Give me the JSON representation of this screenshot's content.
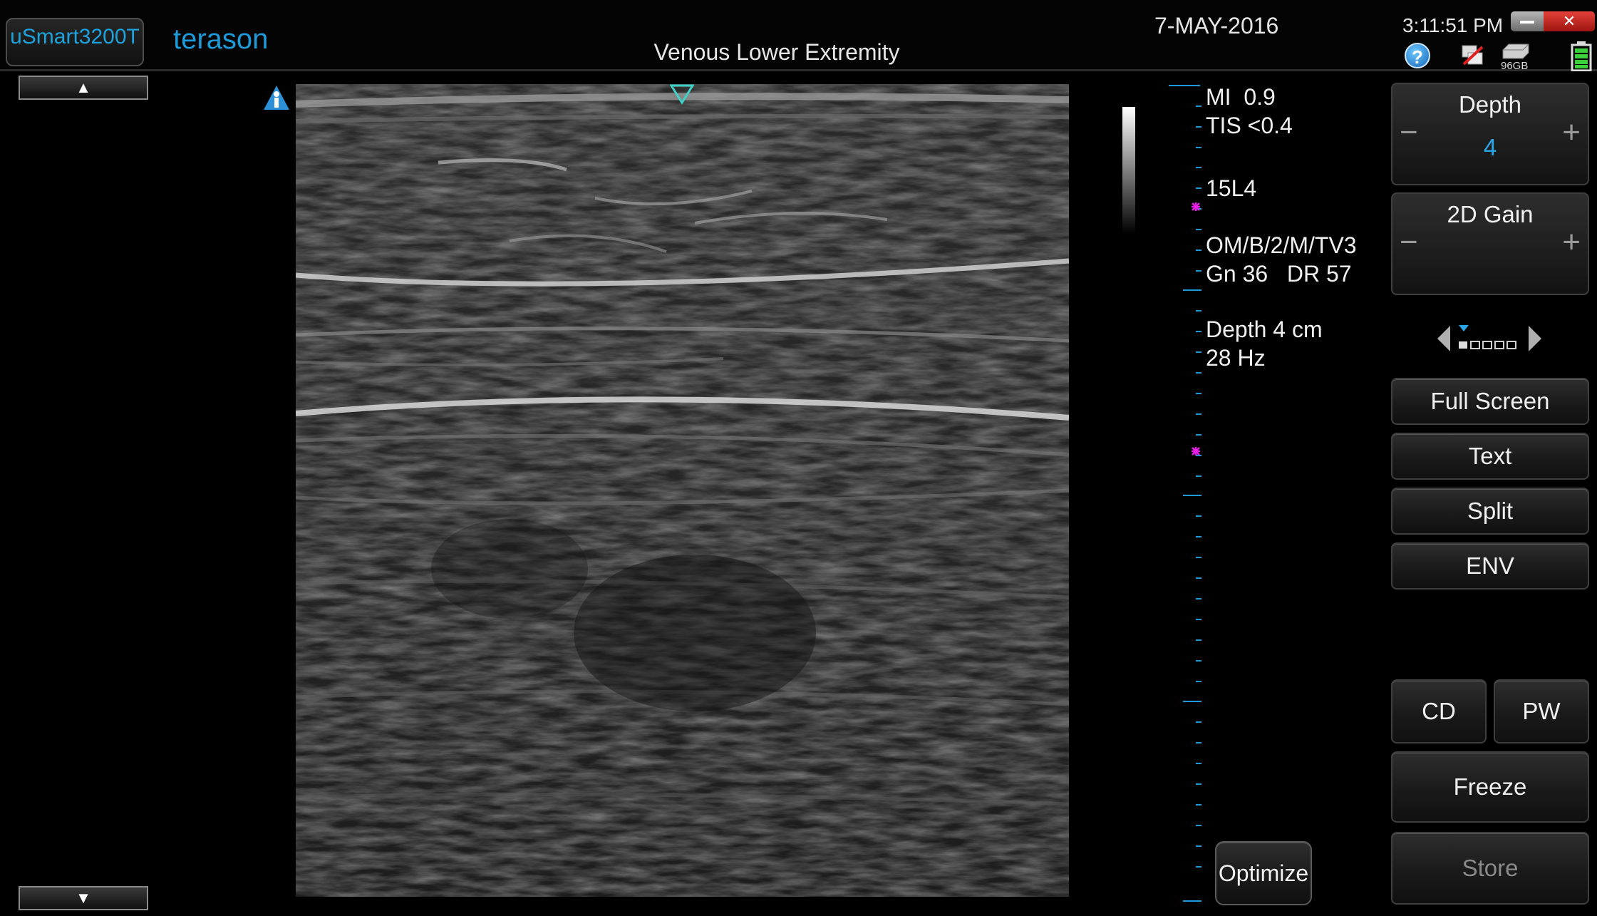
{
  "header": {
    "app_button": "uSmart3200T",
    "brand": "terason",
    "exam_title": "Venous Lower Extremity",
    "date": "7-MAY-2016",
    "time": "3:11:51 PM",
    "help_icon": "help-icon",
    "drive_label": "96GB"
  },
  "left_panel": {
    "scroll_up": "▲",
    "scroll_down": "▼"
  },
  "parameters": {
    "mi": "MI  0.9",
    "tis": "TIS <0.4",
    "transducer": "15L4",
    "mode": "OM/B/2/M/TV3",
    "gain_dr": "Gn 36   DR 57",
    "depth": "Depth 4 cm",
    "frame_rate": "28 Hz"
  },
  "controls": {
    "depth": {
      "label": "Depth",
      "value": "4",
      "minus": "−",
      "plus": "+"
    },
    "gain": {
      "label": "2D Gain",
      "minus": "−",
      "plus": "+"
    },
    "full_screen": "Full Screen",
    "text": "Text",
    "split": "Split",
    "env": "ENV",
    "cd": "CD",
    "pw": "PW",
    "freeze": "Freeze",
    "store": "Store",
    "optimize": "Optimize"
  },
  "colors": {
    "accent": "#1e9ad8",
    "scale": "#1e9ad8",
    "focus_marker": "#e81ee8",
    "store_disabled": "#8a8a8a"
  }
}
